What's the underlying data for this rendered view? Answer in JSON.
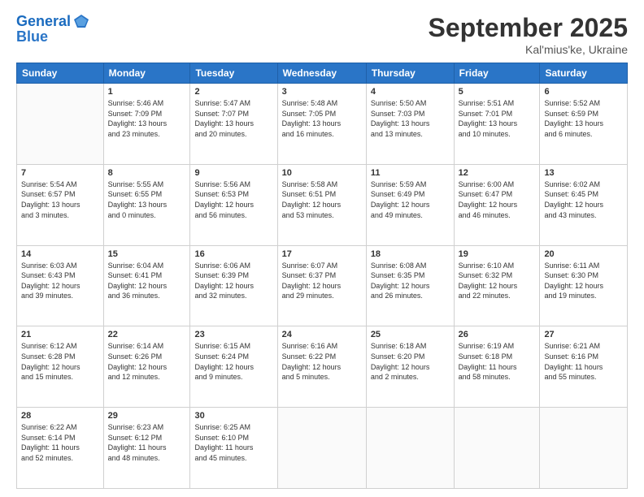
{
  "header": {
    "logo_line1": "General",
    "logo_line2": "Blue",
    "month": "September 2025",
    "location": "Kal'mius'ke, Ukraine"
  },
  "weekdays": [
    "Sunday",
    "Monday",
    "Tuesday",
    "Wednesday",
    "Thursday",
    "Friday",
    "Saturday"
  ],
  "weeks": [
    [
      {
        "day": "",
        "text": ""
      },
      {
        "day": "1",
        "text": "Sunrise: 5:46 AM\nSunset: 7:09 PM\nDaylight: 13 hours\nand 23 minutes."
      },
      {
        "day": "2",
        "text": "Sunrise: 5:47 AM\nSunset: 7:07 PM\nDaylight: 13 hours\nand 20 minutes."
      },
      {
        "day": "3",
        "text": "Sunrise: 5:48 AM\nSunset: 7:05 PM\nDaylight: 13 hours\nand 16 minutes."
      },
      {
        "day": "4",
        "text": "Sunrise: 5:50 AM\nSunset: 7:03 PM\nDaylight: 13 hours\nand 13 minutes."
      },
      {
        "day": "5",
        "text": "Sunrise: 5:51 AM\nSunset: 7:01 PM\nDaylight: 13 hours\nand 10 minutes."
      },
      {
        "day": "6",
        "text": "Sunrise: 5:52 AM\nSunset: 6:59 PM\nDaylight: 13 hours\nand 6 minutes."
      }
    ],
    [
      {
        "day": "7",
        "text": "Sunrise: 5:54 AM\nSunset: 6:57 PM\nDaylight: 13 hours\nand 3 minutes."
      },
      {
        "day": "8",
        "text": "Sunrise: 5:55 AM\nSunset: 6:55 PM\nDaylight: 13 hours\nand 0 minutes."
      },
      {
        "day": "9",
        "text": "Sunrise: 5:56 AM\nSunset: 6:53 PM\nDaylight: 12 hours\nand 56 minutes."
      },
      {
        "day": "10",
        "text": "Sunrise: 5:58 AM\nSunset: 6:51 PM\nDaylight: 12 hours\nand 53 minutes."
      },
      {
        "day": "11",
        "text": "Sunrise: 5:59 AM\nSunset: 6:49 PM\nDaylight: 12 hours\nand 49 minutes."
      },
      {
        "day": "12",
        "text": "Sunrise: 6:00 AM\nSunset: 6:47 PM\nDaylight: 12 hours\nand 46 minutes."
      },
      {
        "day": "13",
        "text": "Sunrise: 6:02 AM\nSunset: 6:45 PM\nDaylight: 12 hours\nand 43 minutes."
      }
    ],
    [
      {
        "day": "14",
        "text": "Sunrise: 6:03 AM\nSunset: 6:43 PM\nDaylight: 12 hours\nand 39 minutes."
      },
      {
        "day": "15",
        "text": "Sunrise: 6:04 AM\nSunset: 6:41 PM\nDaylight: 12 hours\nand 36 minutes."
      },
      {
        "day": "16",
        "text": "Sunrise: 6:06 AM\nSunset: 6:39 PM\nDaylight: 12 hours\nand 32 minutes."
      },
      {
        "day": "17",
        "text": "Sunrise: 6:07 AM\nSunset: 6:37 PM\nDaylight: 12 hours\nand 29 minutes."
      },
      {
        "day": "18",
        "text": "Sunrise: 6:08 AM\nSunset: 6:35 PM\nDaylight: 12 hours\nand 26 minutes."
      },
      {
        "day": "19",
        "text": "Sunrise: 6:10 AM\nSunset: 6:32 PM\nDaylight: 12 hours\nand 22 minutes."
      },
      {
        "day": "20",
        "text": "Sunrise: 6:11 AM\nSunset: 6:30 PM\nDaylight: 12 hours\nand 19 minutes."
      }
    ],
    [
      {
        "day": "21",
        "text": "Sunrise: 6:12 AM\nSunset: 6:28 PM\nDaylight: 12 hours\nand 15 minutes."
      },
      {
        "day": "22",
        "text": "Sunrise: 6:14 AM\nSunset: 6:26 PM\nDaylight: 12 hours\nand 12 minutes."
      },
      {
        "day": "23",
        "text": "Sunrise: 6:15 AM\nSunset: 6:24 PM\nDaylight: 12 hours\nand 9 minutes."
      },
      {
        "day": "24",
        "text": "Sunrise: 6:16 AM\nSunset: 6:22 PM\nDaylight: 12 hours\nand 5 minutes."
      },
      {
        "day": "25",
        "text": "Sunrise: 6:18 AM\nSunset: 6:20 PM\nDaylight: 12 hours\nand 2 minutes."
      },
      {
        "day": "26",
        "text": "Sunrise: 6:19 AM\nSunset: 6:18 PM\nDaylight: 11 hours\nand 58 minutes."
      },
      {
        "day": "27",
        "text": "Sunrise: 6:21 AM\nSunset: 6:16 PM\nDaylight: 11 hours\nand 55 minutes."
      }
    ],
    [
      {
        "day": "28",
        "text": "Sunrise: 6:22 AM\nSunset: 6:14 PM\nDaylight: 11 hours\nand 52 minutes."
      },
      {
        "day": "29",
        "text": "Sunrise: 6:23 AM\nSunset: 6:12 PM\nDaylight: 11 hours\nand 48 minutes."
      },
      {
        "day": "30",
        "text": "Sunrise: 6:25 AM\nSunset: 6:10 PM\nDaylight: 11 hours\nand 45 minutes."
      },
      {
        "day": "",
        "text": ""
      },
      {
        "day": "",
        "text": ""
      },
      {
        "day": "",
        "text": ""
      },
      {
        "day": "",
        "text": ""
      }
    ]
  ]
}
